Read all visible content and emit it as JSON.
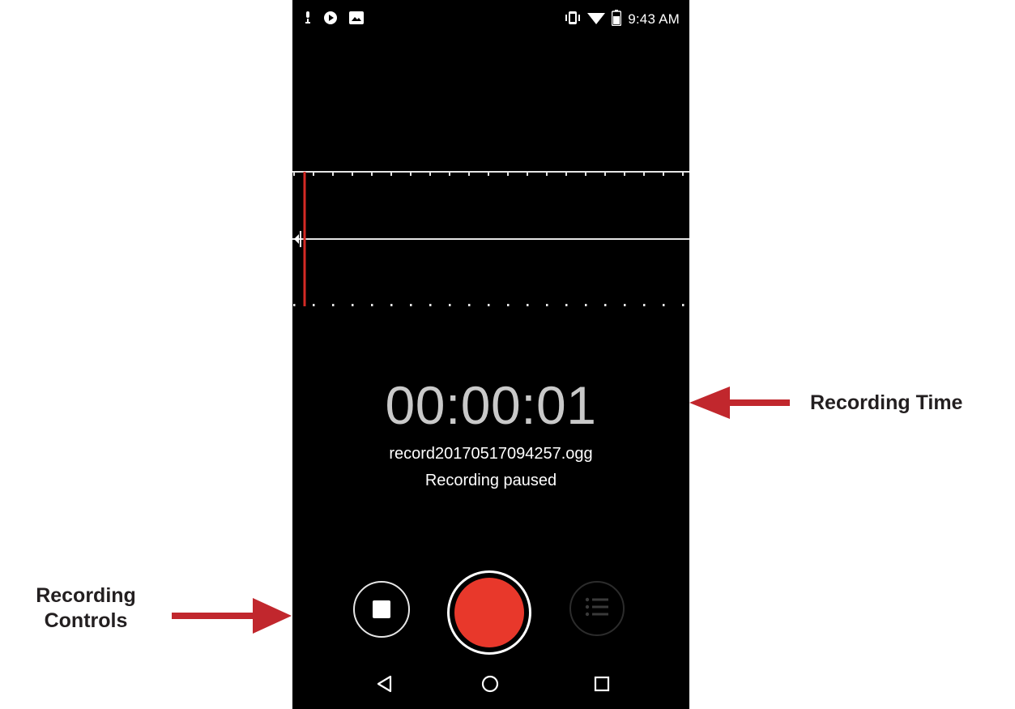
{
  "status_bar": {
    "time": "9:43 AM",
    "left_icons": [
      "mic-notification-icon",
      "media-notification-icon",
      "image-notification-icon"
    ],
    "right_icons": [
      "vibrate-icon",
      "wifi-icon",
      "battery-icon"
    ]
  },
  "recorder": {
    "elapsed_time": "00:00:01",
    "file_name": "record20170517094257.ogg",
    "status": "Recording paused",
    "accent_color": "#e8382b"
  },
  "controls": {
    "stop_icon": "stop-icon",
    "record_icon": "record-icon",
    "list_icon": "list-icon"
  },
  "nav": {
    "back_icon": "back-triangle-icon",
    "home_icon": "home-circle-icon",
    "recents_icon": "recents-square-icon"
  },
  "annotations": {
    "recording_time_label": "Recording Time",
    "recording_controls_line1": "Recording",
    "recording_controls_line2": "Controls",
    "arrow_color": "#c1272d"
  }
}
